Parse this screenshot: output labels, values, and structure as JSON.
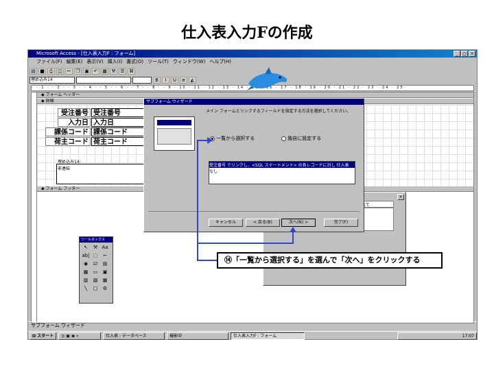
{
  "slide_title": "仕入表入力Fの作成",
  "window": {
    "title": "Microsoft Access - [仕入表入力F : フォーム]",
    "menu": [
      "ファイル(F)",
      "編集(E)",
      "表示(V)",
      "挿入(I)",
      "書式(O)",
      "ツール(T)",
      "ウィンドウ(W)",
      "ヘルプ(H)"
    ],
    "object_combo": "埋め込み14",
    "win_controls": [
      "_",
      "□",
      "×"
    ]
  },
  "form": {
    "header_band": "フォーム ヘッダー",
    "detail_band": "詳細",
    "footer_band": "フォーム フッター",
    "fields": [
      {
        "label": "受注番号",
        "control": "受注番号"
      },
      {
        "label": "入力日",
        "control": "入力日"
      },
      {
        "label": "課係コード",
        "control": "課係コード"
      },
      {
        "label": "荷主コード",
        "control": "荷主コード"
      }
    ],
    "embedded_label": "埋め込み14:",
    "embedded_unbound": "非連結"
  },
  "wizard": {
    "title": "サブフォーム ウィザード",
    "prompt": "メイン フォームとリンクするフィールドを指定する方法を選択してください。",
    "option_list": "一覧から選択する",
    "option_custom": "独自に設定する",
    "list_items": [
      "受注番号 でリンクし、<SQL ステートメント> の各レコードに対し 仕入表",
      "なし"
    ],
    "buttons": {
      "cancel": "キャンセル",
      "back": "< 戻る(B)",
      "next": "次へ(N) >",
      "finish": "完了(F)"
    }
  },
  "sub_window": {
    "tab": "べて"
  },
  "toolbox": {
    "title": "ツールボックス",
    "tools": [
      "↖",
      "⚒",
      "Aa",
      "ab|",
      "⬚",
      "⌐",
      "◉",
      "☑",
      "▤",
      "▦",
      "▭",
      "▣",
      "▥",
      "▧",
      "▦",
      "╲",
      "□",
      "⚙"
    ]
  },
  "status": "サブフォーム ウィザード",
  "taskbar": {
    "start": "スタート",
    "tasks": [
      "仕入表 : データベース",
      "撮影中",
      "仕入表入力F : フォーム"
    ],
    "clock": "17:07",
    "tray": [
      "A",
      "般"
    ]
  },
  "callout": "⑭「一覧から選択する」を選んで「次へ」をクリックする",
  "colors": {
    "highlight": "#000080",
    "arrow": "#3344cc",
    "dolphin": "#2a8de0"
  }
}
